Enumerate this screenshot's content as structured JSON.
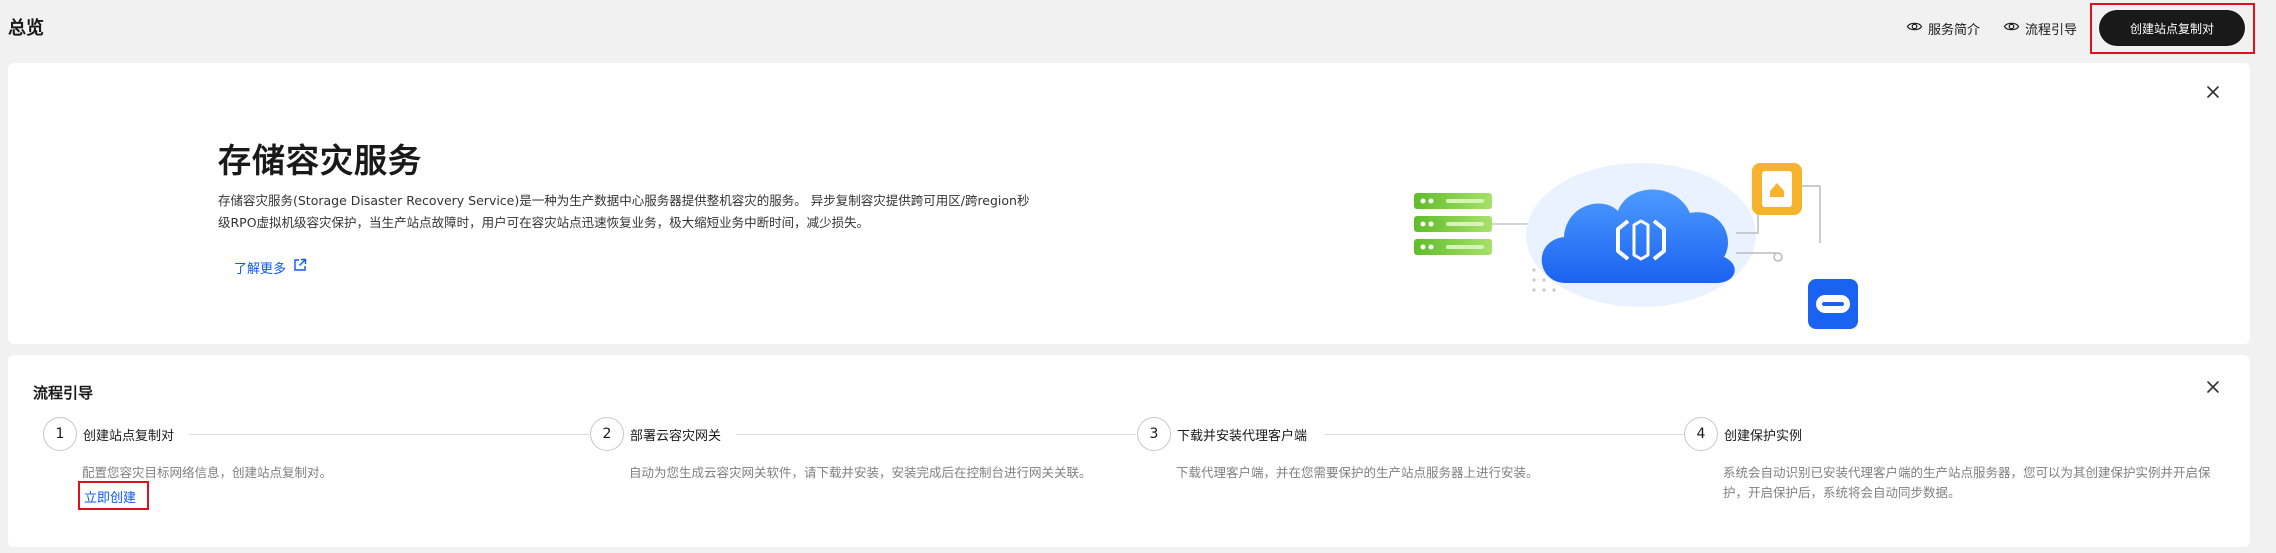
{
  "header": {
    "title": "总览",
    "intro_link": "服务简介",
    "guide_link": "流程引导",
    "create_button": "创建站点复制对"
  },
  "intro": {
    "title": "存储容灾服务",
    "description": "存储容灾服务(Storage Disaster Recovery Service)是一种为生产数据中心服务器提供整机容灾的服务。 异步复制容灾提供跨可用区/跨region秒级RPO虚拟机级容灾保护，当生产站点故障时，用户可在容灾站点迅速恢复业务，极大缩短业务中断时间，减少损失。",
    "learn_more": "了解更多"
  },
  "guide": {
    "title": "流程引导",
    "steps": [
      {
        "num": "1",
        "label": "创建站点复制对",
        "desc": "配置您容灾目标网络信息，创建站点复制对。",
        "action": "立即创建"
      },
      {
        "num": "2",
        "label": "部署云容灾网关",
        "desc": "自动为您生成云容灾网关软件，请下载并安装，安装完成后在控制台进行网关关联。"
      },
      {
        "num": "3",
        "label": "下载并安装代理客户端",
        "desc": "下载代理客户端，并在您需要保护的生产站点服务器上进行安装。"
      },
      {
        "num": "4",
        "label": "创建保护实例",
        "desc": "系统会自动识别已安装代理客户端的生产站点服务器，您可以为其创建保护实例并开启保护，开启保护后，系统将会自动同步数据。"
      }
    ]
  },
  "colors": {
    "primary_button": "#191919",
    "link": "#0a59f7",
    "highlight_border": "#e0101e",
    "cloud_blue": "#2f7dfb",
    "server_green": "#7fcf3b",
    "shield_orange": "#f7b32b"
  }
}
